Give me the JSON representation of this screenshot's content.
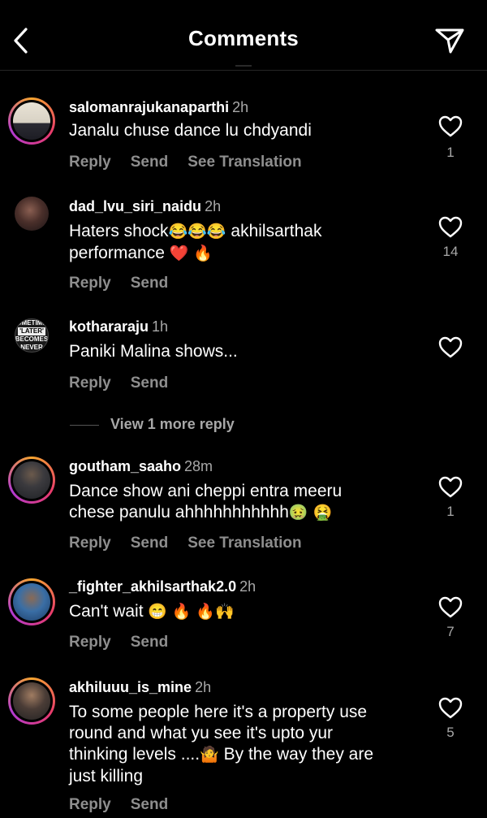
{
  "header": {
    "title": "Comments"
  },
  "comments": [
    {
      "username": "salomanrajukanaparthi",
      "time": "2h",
      "text": "Janalu chuse dance lu chdyandi",
      "likes": "1",
      "actions": [
        "Reply",
        "Send",
        "See Translation"
      ]
    },
    {
      "username": "dad_lvu_siri_naidu",
      "time": "2h",
      "text_line1": "Haters shock",
      "text_line1_tail": " akhilsarthak",
      "text_line2": "performance ",
      "likes": "14",
      "actions": [
        "Reply",
        "Send"
      ]
    },
    {
      "username": "kothararaju",
      "time": "1h",
      "text": "Paniki Malina shows...",
      "likes": "",
      "actions": [
        "Reply",
        "Send"
      ],
      "avatar_text": [
        "SOMETIMES",
        "'LATER'",
        "BECOMES",
        "NEVER"
      ]
    },
    {
      "username": "goutham_saaho",
      "time": "28m",
      "text_line1": "Dance show ani cheppi entra meeru",
      "text_line2": "chese panulu ahhhhhhhhhhh",
      "likes": "1",
      "actions": [
        "Reply",
        "Send",
        "See Translation"
      ]
    },
    {
      "username": "_fighter_akhilsarthak2.0",
      "time": "2h",
      "text": "Can't wait ",
      "likes": "7",
      "actions": [
        "Reply",
        "Send"
      ]
    },
    {
      "username": "akhiluuu_is_mine",
      "time": "2h",
      "text_line1": "To some people here it's a property use",
      "text_line2": "round and what yu see it's upto yur",
      "text_line3": "thinking levels ....",
      "text_line3_tail": " By the way they are",
      "text_line4": "just killing",
      "likes": "5",
      "actions": [
        "Reply",
        "Send"
      ]
    }
  ],
  "view_more": "View 1 more reply",
  "emoji": {
    "laugh": "😂",
    "heart": "❤️",
    "fire": "🔥",
    "nausea": "🤢",
    "vomit": "🤮",
    "grin": "😁",
    "raised_hands": "🙌",
    "shrug": "🤷"
  },
  "colors": {
    "background": "#000000",
    "secondary_text": "#a8a8a8",
    "action_text": "#8e8e8e"
  }
}
